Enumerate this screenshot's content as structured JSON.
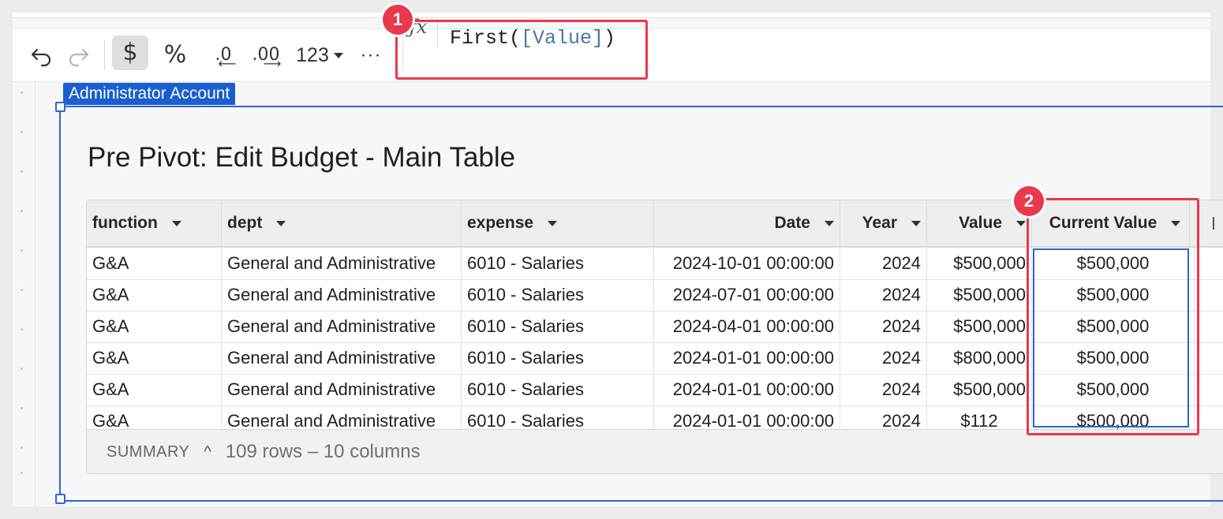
{
  "toolbar": {
    "undo_icon": "undo-icon",
    "redo_icon": "redo-icon",
    "currency_symbol": "$",
    "percent_symbol": "%",
    "decrease_decimals": ".0",
    "increase_decimals": ".00",
    "number_format_label": "123",
    "more_label": "···"
  },
  "formula_bar": {
    "fx_symbol": "ƒx",
    "text_prefix": "First(",
    "text_ref": "[Value]",
    "text_suffix": ")"
  },
  "callouts": {
    "one": "1",
    "two": "2"
  },
  "element": {
    "tag": "Administrator Account",
    "title": "Pre Pivot: Edit Budget - Main Table"
  },
  "table": {
    "columns": [
      "function",
      "dept",
      "expense",
      "Date",
      "Year",
      "Value",
      "Current Value"
    ],
    "rows": [
      [
        "G&A",
        "General and Administrative",
        "6010 - Salaries",
        "2024-10-01 00:00:00",
        "2024",
        "$500,000",
        "$500,000"
      ],
      [
        "G&A",
        "General and Administrative",
        "6010 - Salaries",
        "2024-07-01 00:00:00",
        "2024",
        "$500,000",
        "$500,000"
      ],
      [
        "G&A",
        "General and Administrative",
        "6010 - Salaries",
        "2024-04-01 00:00:00",
        "2024",
        "$500,000",
        "$500,000"
      ],
      [
        "G&A",
        "General and Administrative",
        "6010 - Salaries",
        "2024-01-01 00:00:00",
        "2024",
        "$800,000",
        "$500,000"
      ],
      [
        "G&A",
        "General and Administrative",
        "6010 - Salaries",
        "2024-01-01 00:00:00",
        "2024",
        "$500,000",
        "$500,000"
      ],
      [
        "G&A",
        "General and Administrative",
        "6010 - Salaries",
        "2024-01-01 00:00:00",
        "2024",
        "$112",
        "$500,000"
      ]
    ],
    "summary": {
      "label": "SUMMARY",
      "chevron": "^",
      "count": "109 rows – 10 columns"
    }
  },
  "colors": {
    "callout": "#e8394d",
    "selection": "#2c67d3",
    "tag_bg": "#1a5fd0",
    "formula_ref": "#4a78a8"
  }
}
